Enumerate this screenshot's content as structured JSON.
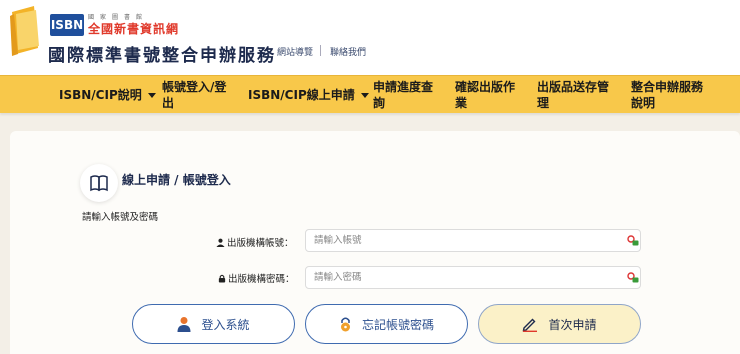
{
  "header": {
    "logo_mark": "ISBN",
    "logo_small_text": "國家圖書館",
    "logo_subtitle": "全國新書資訊網",
    "site_title": "國際標準書號整合申辦服務",
    "links": [
      "網站導覽",
      "聯絡我們"
    ]
  },
  "nav": {
    "items": [
      {
        "label": "ISBN/CIP說明",
        "dropdown": true
      },
      {
        "label": "帳號登入/登出",
        "dropdown": false
      },
      {
        "label": "ISBN/CIP線上申請",
        "dropdown": true
      },
      {
        "label": "申請進度查詢",
        "dropdown": false
      },
      {
        "label": "確認出版作業",
        "dropdown": false
      },
      {
        "label": "出版品送存管理",
        "dropdown": false
      },
      {
        "label": "整合申辦服務說明",
        "dropdown": false
      }
    ]
  },
  "login": {
    "section_title": "線上申請 / 帳號登入",
    "hint": "請輸入帳號及密碼",
    "account_label": "出版機構帳號：",
    "account_placeholder": "請輸入帳號",
    "account_value": "",
    "password_label": "出版機構密碼：",
    "password_placeholder": "請輸入密碼",
    "password_value": ""
  },
  "buttons": {
    "login": "登入系統",
    "forgot": "忘記帳號密碼",
    "first_apply": "首次申請"
  },
  "colors": {
    "nav_bg": "#f8c84a",
    "brand_blue": "#2c4f8e",
    "accent_red": "#e0392b",
    "primary_button_bg": "#fbf1c8"
  },
  "icons": {
    "book": "book-icon",
    "user": "user-icon",
    "lock": "lock-icon",
    "key": "password-manager-icon",
    "login": "person-icon",
    "forgot": "lock-keyhole-icon",
    "apply": "pencil-icon"
  }
}
